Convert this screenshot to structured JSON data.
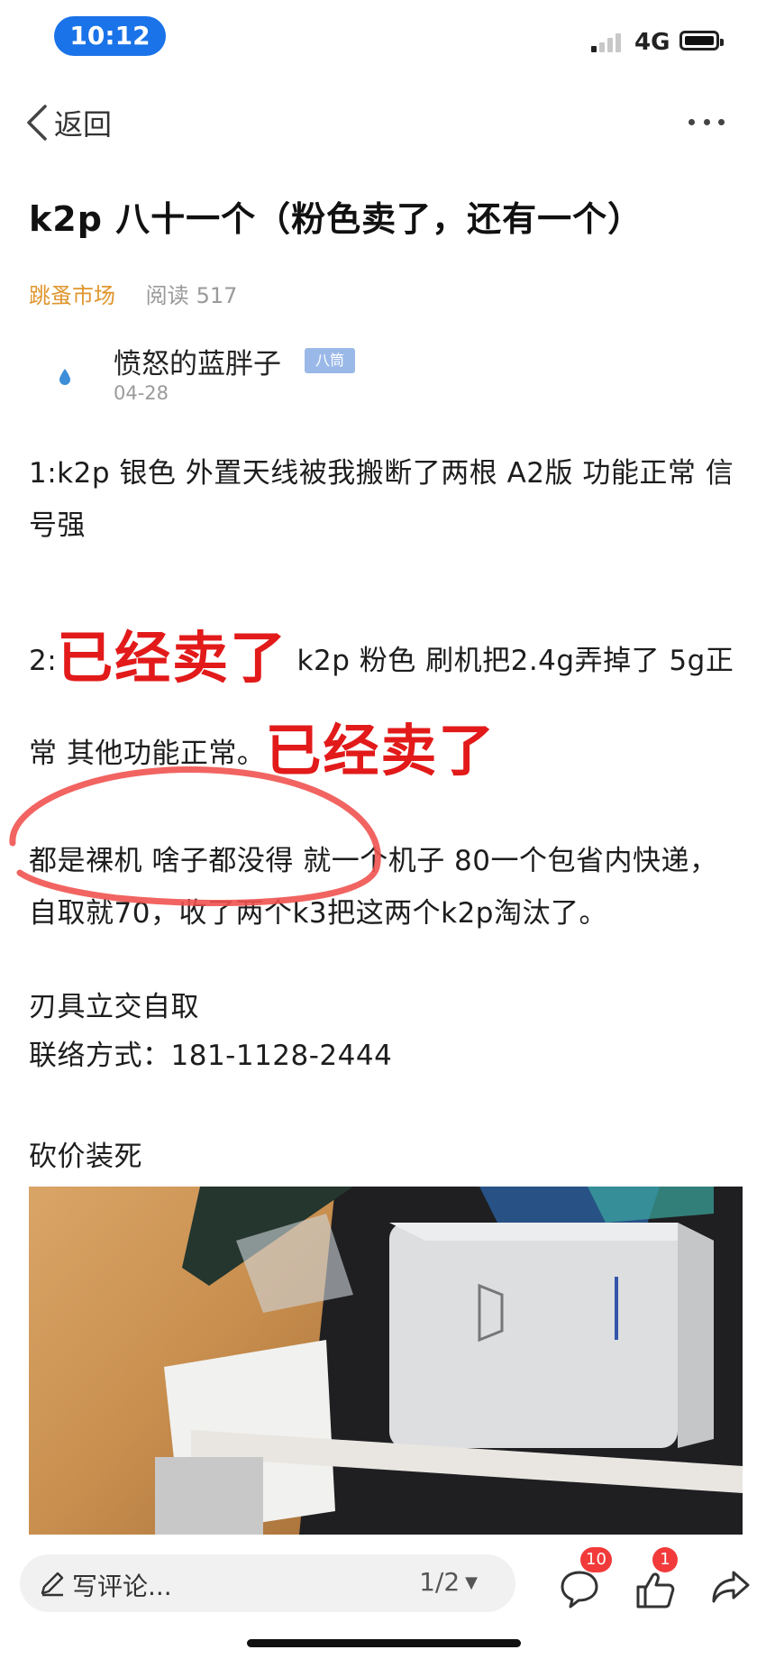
{
  "status_bar": {
    "time": "10:12",
    "network": "4G",
    "signal_bars_active": 1,
    "signal_bars_total": 4
  },
  "nav": {
    "back_label": "返回"
  },
  "post": {
    "title": "k2p 八十一个（粉色卖了，还有一个）",
    "forum": "跳蚤市场",
    "read_label": "阅读",
    "read_count": "517",
    "author": {
      "name": "愤怒的蓝胖子",
      "level": "八筒",
      "date": "04-28"
    },
    "paragraphs": {
      "p1": "1:k2p 银色 外置天线被我搬断了两根 A2版 功能正常 信号强",
      "p2_prefix": "2:",
      "sold_label": "已经卖了",
      "p2_main": " k2p 粉色 刷机把2.4g弄掉了 5g正常 其他功能正常。",
      "p3": "都是裸机 啥子都没得 就一个机子 80一个包省内快递，自取就70，收了两个k3把这两个k2p淘汰了。",
      "p4_line1": "刃具立交自取",
      "p4_line2": "联络方式：181-1128-2444",
      "p5": "砍价装死"
    }
  },
  "bottom_bar": {
    "comment_placeholder": "写评论...",
    "page_indicator": "1/2",
    "comment_count": "10",
    "like_count": "1"
  },
  "colors": {
    "time_pill": "#1a73e8",
    "forum": "#e0962d",
    "sold": "#e21a1a",
    "badge": "#f23a3a",
    "level_badge": "#9bb9e8"
  }
}
